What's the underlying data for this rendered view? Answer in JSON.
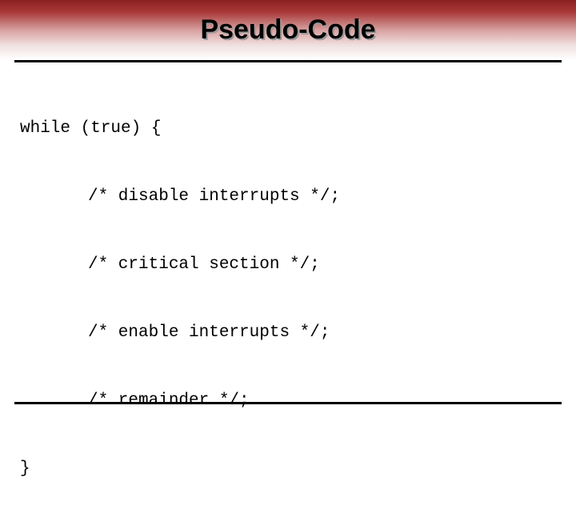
{
  "title": "Pseudo-Code",
  "code": {
    "line1": "while (true) {",
    "line2": "/* disable interrupts */;",
    "line3": "/* critical section */;",
    "line4": "/* enable interrupts */;",
    "line5": "/* remainder */;",
    "line6": "}"
  }
}
